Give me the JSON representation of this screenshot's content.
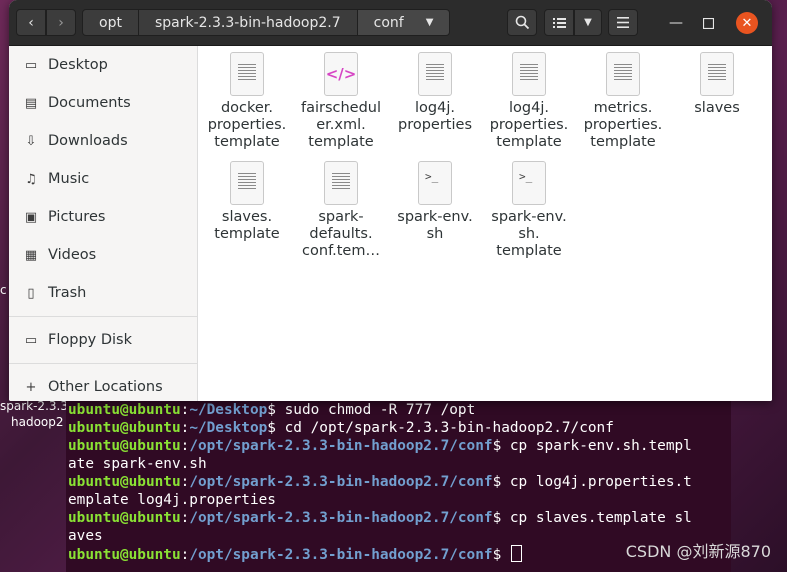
{
  "desktop": {
    "text1": "c",
    "text2": "spark-2.3.3",
    "text3": "hadoop2"
  },
  "window": {
    "breadcrumbs": [
      "opt",
      "spark-2.3.3-bin-hadoop2.7",
      "conf"
    ],
    "buttons": {
      "back": "‹",
      "forward": "›",
      "search": "⌕",
      "view": "☰",
      "view_menu": "▾",
      "menu": "≡",
      "minimize": "—",
      "maximize": "☐",
      "close": "✕"
    }
  },
  "sidebar": {
    "items": [
      {
        "label": "Desktop",
        "icon": "desktop-icon"
      },
      {
        "label": "Documents",
        "icon": "documents-icon"
      },
      {
        "label": "Downloads",
        "icon": "downloads-icon"
      },
      {
        "label": "Music",
        "icon": "music-icon"
      },
      {
        "label": "Pictures",
        "icon": "pictures-icon"
      },
      {
        "label": "Videos",
        "icon": "videos-icon"
      },
      {
        "label": "Trash",
        "icon": "trash-icon"
      }
    ],
    "devices": [
      {
        "label": "Floppy Disk",
        "icon": "floppy-disk-icon"
      }
    ],
    "other": {
      "label": "Other Locations",
      "icon": "plus-icon"
    }
  },
  "files": [
    {
      "name": "docker.\nproperties.\ntemplate",
      "type": "text"
    },
    {
      "name": "fairschedul\ner.xml.\ntemplate",
      "type": "xml"
    },
    {
      "name": "log4j.\nproperties",
      "type": "text"
    },
    {
      "name": "log4j.\nproperties.\ntemplate",
      "type": "text"
    },
    {
      "name": "metrics.\nproperties.\ntemplate",
      "type": "text"
    },
    {
      "name": "slaves",
      "type": "text"
    },
    {
      "name": "slaves.\ntemplate",
      "type": "text"
    },
    {
      "name": "spark-\ndefaults.\nconf.tem…",
      "type": "text"
    },
    {
      "name": "spark-env.\nsh",
      "type": "sh"
    },
    {
      "name": "spark-env.\nsh.\ntemplate",
      "type": "sh"
    }
  ],
  "terminal": {
    "user": "ubuntu@ubuntu",
    "lines": [
      {
        "path": "~/Desktop",
        "cmd": "$ sudo chmod -R 777 /opt"
      },
      {
        "path": "~/Desktop",
        "cmd": "$ cd /opt/spark-2.3.3-bin-hadoop2.7/conf"
      },
      {
        "path": "/opt/spark-2.3.3-bin-hadoop2.7/conf",
        "cmd": "$ cp spark-env.sh.templ"
      },
      {
        "text": "ate spark-env.sh"
      },
      {
        "path": "/opt/spark-2.3.3-bin-hadoop2.7/conf",
        "cmd": "$ cp log4j.properties.t"
      },
      {
        "text": "emplate log4j.properties"
      },
      {
        "path": "/opt/spark-2.3.3-bin-hadoop2.7/conf",
        "cmd": "$ cp slaves.template sl"
      },
      {
        "text": "aves"
      },
      {
        "path": "/opt/spark-2.3.3-bin-hadoop2.7/conf",
        "cmd": "$ "
      }
    ]
  },
  "watermark": "CSDN @刘新源870"
}
